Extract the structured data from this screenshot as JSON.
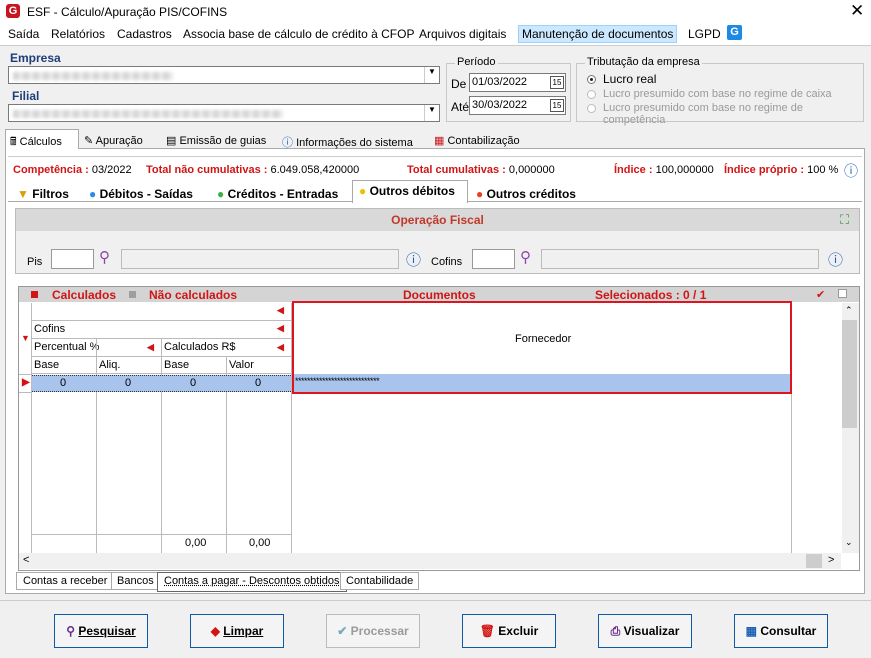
{
  "window": {
    "title": "ESF - Cálculo/Apuração PIS/COFINS",
    "logo": "G"
  },
  "menu": [
    "Saída",
    "Relatórios",
    "Cadastros",
    "Associa base de cálculo de crédito à CFOP",
    "Arquivos digitais",
    "Manutenção de documentos",
    "LGPD"
  ],
  "empresa_label": "Empresa",
  "filial_label": "Filial",
  "periodo": {
    "title": "Período",
    "de_label": "De",
    "de": "01/03/2022",
    "ate_label": "Até",
    "ate": "30/03/2022"
  },
  "tributacao": {
    "title": "Tributação da empresa",
    "opt1": "Lucro real",
    "opt2": "Lucro presumido com base no regime de caixa",
    "opt3": "Lucro presumido com base no regime de competência"
  },
  "main_tabs": [
    "Cálculos",
    "Apuração",
    "Emissão de guias",
    "Informações do sistema",
    "Contabilização"
  ],
  "summary": {
    "competencia_label": "Competência :",
    "competencia": "03/2022",
    "tnc_label": "Total não cumulativas :",
    "tnc": "6.049.058,420000",
    "tc_label": "Total cumulativas :",
    "tc": "0,000000",
    "indice_label": "Índice :",
    "indice": "100,000000",
    "proprio_label": "Índice próprio :",
    "proprio": "100 %"
  },
  "sub_tabs": [
    "Filtros",
    "Débitos - Saídas",
    "Créditos - Entradas",
    "Outros débitos",
    "Outros créditos"
  ],
  "operacao": {
    "title": "Operação Fiscal",
    "pis_label": "Pis",
    "cofins_label": "Cofins"
  },
  "grid": {
    "calculados": "Calculados",
    "nao_calculados": "Não calculados",
    "documentos": "Documentos",
    "selecionados": "Selecionados : 0 / 1",
    "cofins": "Cofins",
    "percentual": "Percentual %",
    "calc_rs": "Calculados R$",
    "base": "Base",
    "aliq": "Aliq.",
    "valor": "Valor",
    "fornecedor": "Fornecedor",
    "row": [
      "0",
      "0",
      "0",
      "0"
    ],
    "masked": "****************************",
    "tot_base": "0,00",
    "tot_valor": "0,00"
  },
  "bottom_tabs": [
    "Contas a receber",
    "Bancos",
    "Contas a pagar - Descontos obtidos",
    "Contabilidade"
  ],
  "buttons": {
    "pesquisar": "Pesquisar",
    "limpar": "Limpar",
    "processar": "Processar",
    "excluir": "Excluir",
    "visualizar": "Visualizar",
    "consultar": "Consultar"
  },
  "colors": {
    "accent": "#d21414",
    "selection": "#a9c4ec",
    "highlight_border": "#e0141e"
  }
}
